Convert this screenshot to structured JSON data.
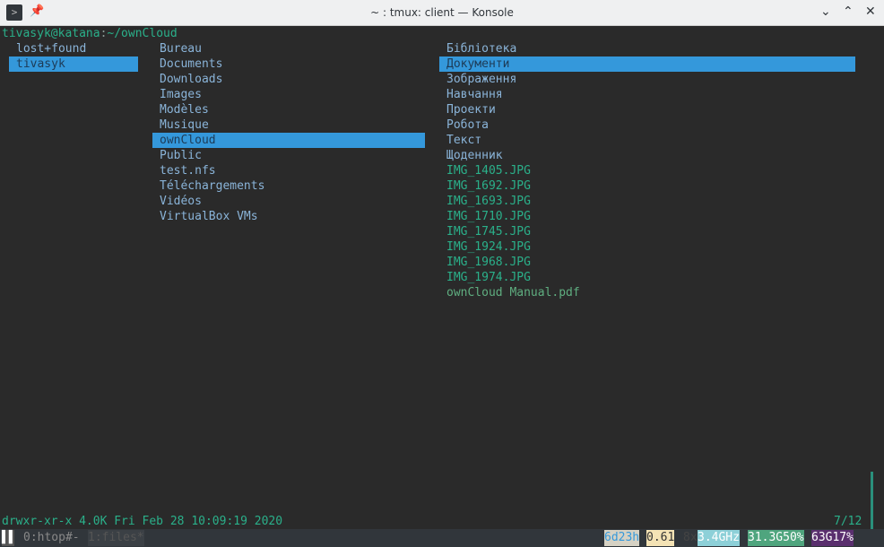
{
  "window": {
    "title": "~ : tmux: client — Konsole",
    "app_icon": "terminal-icon",
    "pin_icon": "pin-icon",
    "minimize": "⌄",
    "maximize": "⌃",
    "close": "✕"
  },
  "prompt": {
    "user_host": "tivasyk@katana",
    "sep": ":",
    "path": "~/ownCloud"
  },
  "col1": [
    "lost+found",
    "tivasyk"
  ],
  "col1_selected": 1,
  "col2": [
    "Bureau",
    "Documents",
    "Downloads",
    "Images",
    "Modèles",
    "Musique",
    "ownCloud",
    "Public",
    "test.nfs",
    "Téléchargements",
    "Vidéos",
    "VirtualBox VMs"
  ],
  "col2_selected": 6,
  "col3_dirs": [
    "Бібліотека",
    "Документи",
    "Зображення",
    "Навчання",
    "Проекти",
    "Робота",
    "Текст",
    "Щоденник"
  ],
  "col3_images": [
    "IMG_1405.JPG",
    "IMG_1692.JPG",
    "IMG_1693.JPG",
    "IMG_1710.JPG",
    "IMG_1745.JPG",
    "IMG_1924.JPG",
    "IMG_1968.JPG",
    "IMG_1974.JPG"
  ],
  "col3_files": [
    "ownCloud Manual.pdf"
  ],
  "col3_selected": 1,
  "info": {
    "perm": "drwxr-xr-x 4.0K Fri Feb 28 10:09:19 2020",
    "position": "7/12"
  },
  "tmux": {
    "win0": "0:htop#-",
    "win1": "1:files*",
    "uptime": "6d23h",
    "load": "0.61",
    "cores": "8x",
    "freq": "3.4GHz",
    "mem": "31.3G50%",
    "disk": "63G17%"
  },
  "colors": {
    "selection": "#3498db",
    "dir": "#8ab4d9",
    "image": "#2ab08a",
    "uptime_bg": "#d6d2c4",
    "load_bg": "#f4e3b5",
    "freq_bg": "#8dd0d8",
    "mem_bg": "#4fa57e",
    "disk_bg": "#5a2f6e"
  }
}
